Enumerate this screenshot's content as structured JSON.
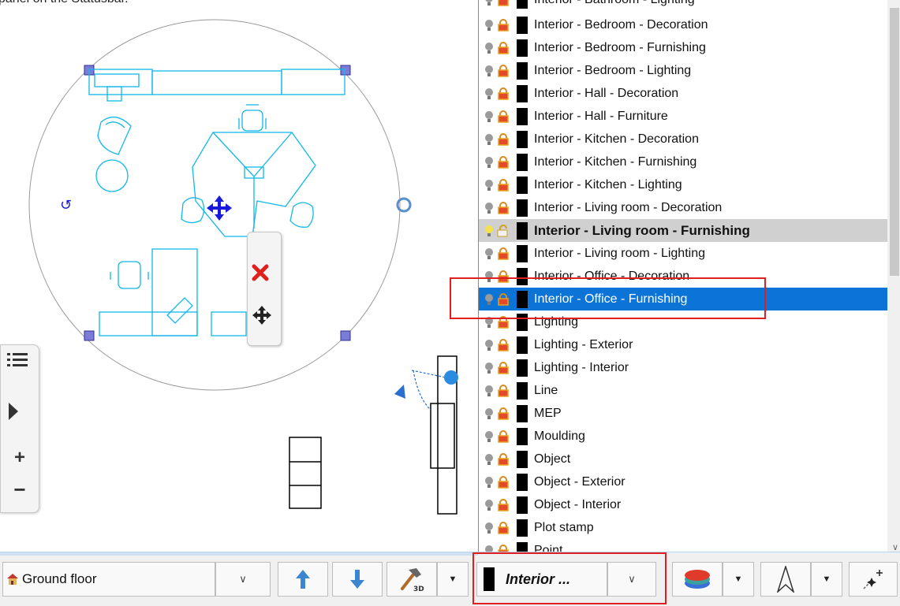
{
  "canvas": {
    "overlay_text": "panel on the Statusbar."
  },
  "context_toolbar": {
    "delete_icon": "red-x-icon",
    "move_icon": "move-arrows-icon"
  },
  "side_nav": {
    "menu_icon": "list-icon",
    "expand_icon": "play-triangle-icon",
    "zoom_in": "+",
    "zoom_out": "−"
  },
  "layers": {
    "top_partial": "Interior - Bathroom - Lighting",
    "items": [
      "Interior - Bedroom - Decoration",
      "Interior - Bedroom - Furnishing",
      "Interior - Bedroom - Lighting",
      "Interior - Hall - Decoration",
      "Interior - Hall - Furniture",
      "Interior - Kitchen - Decoration",
      "Interior - Kitchen - Furnishing",
      "Interior - Kitchen - Lighting",
      "Interior - Living room - Decoration",
      "Interior - Living room - Furnishing",
      "Interior - Living room - Lighting",
      "Interior - Office - Decoration",
      "Interior - Office - Furnishing",
      "Lighting",
      "Lighting - Exterior",
      "Lighting - Interior",
      "Line",
      "MEP",
      "Moulding",
      "Object",
      "Object - Exterior",
      "Object - Interior",
      "Plot stamp",
      "Point"
    ],
    "active": "Interior - Living room - Furnishing",
    "selected": "Interior - Office - Furnishing"
  },
  "statusbar": {
    "floor_label": "Ground floor",
    "floor_icon": "house-levels-icon",
    "up_icon": "arrow-up-icon",
    "down_icon": "arrow-down-icon",
    "hammer_icon": "hammer-3d-icon",
    "hammer_badge": "3D",
    "layer_label": "Interior ...",
    "layers_icon": "layer-stack-icon",
    "north_icon": "north-arrow-icon",
    "snap_icon": "snap-sparkle-icon"
  },
  "colors": {
    "selection_blue": "#0b74d6",
    "drawing_cyan": "#12b8e8",
    "highlight_red": "#e02020"
  }
}
